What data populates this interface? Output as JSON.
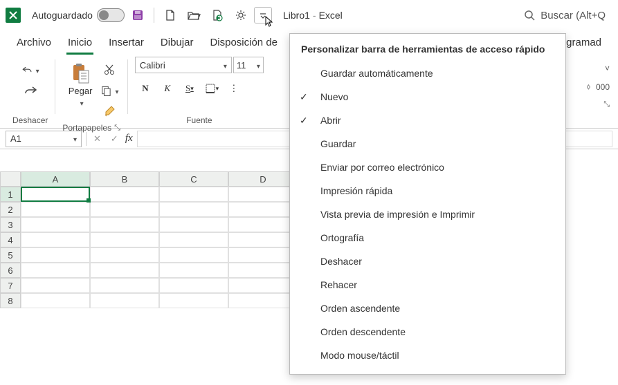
{
  "titlebar": {
    "autoguardado_label": "Autoguardado",
    "doc_name": "Libro1",
    "app_name": "Excel",
    "search_placeholder": "Buscar (Alt+Q"
  },
  "tabs": [
    "Archivo",
    "Inicio",
    "Insertar",
    "Dibujar",
    "Disposición de",
    "gramad"
  ],
  "active_tab_index": 1,
  "ribbon": {
    "undo_group": "Deshacer",
    "clipboard_group": "Portapapeles",
    "paste_label": "Pegar",
    "font_group": "Fuente",
    "font_name": "Calibri",
    "font_size": "11",
    "bold": "N",
    "italic": "K",
    "underline": "S",
    "right_icon1": "⋄",
    "right_icon2": "000"
  },
  "namebox": "A1",
  "columns": [
    "A",
    "B",
    "C",
    "D"
  ],
  "rows": [
    "1",
    "2",
    "3",
    "4",
    "5",
    "6",
    "7",
    "8"
  ],
  "dropdown": {
    "title": "Personalizar barra de herramientas de acceso rápido",
    "items": [
      {
        "label": "Guardar automáticamente",
        "checked": false
      },
      {
        "label": "Nuevo",
        "checked": true
      },
      {
        "label": "Abrir",
        "checked": true
      },
      {
        "label": "Guardar",
        "checked": false
      },
      {
        "label": "Enviar por correo electrónico",
        "checked": false
      },
      {
        "label": "Impresión rápida",
        "checked": false
      },
      {
        "label": "Vista previa de impresión e Imprimir",
        "checked": false
      },
      {
        "label": "Ortografía",
        "checked": false
      },
      {
        "label": "Deshacer",
        "checked": false
      },
      {
        "label": "Rehacer",
        "checked": false
      },
      {
        "label": "Orden ascendente",
        "checked": false
      },
      {
        "label": "Orden descendente",
        "checked": false
      },
      {
        "label": "Modo mouse/táctil",
        "checked": false
      }
    ]
  }
}
